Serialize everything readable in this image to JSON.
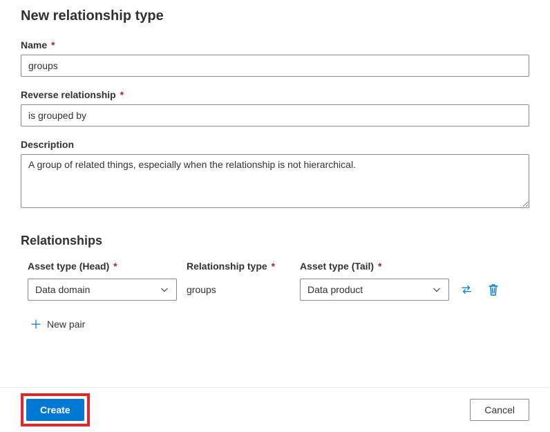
{
  "title": "New relationship type",
  "fields": {
    "name": {
      "label": "Name",
      "value": "groups"
    },
    "reverse": {
      "label": "Reverse relationship",
      "value": "is grouped by"
    },
    "description": {
      "label": "Description",
      "value": "A group of related things, especially when the relationship is not hierarchical."
    }
  },
  "relationships": {
    "heading": "Relationships",
    "columns": {
      "head": "Asset type (Head)",
      "relType": "Relationship type",
      "tail": "Asset type (Tail)"
    },
    "rows": [
      {
        "head": "Data domain",
        "relType": "groups",
        "tail": "Data product"
      }
    ],
    "newPairLabel": "New pair"
  },
  "footer": {
    "create": "Create",
    "cancel": "Cancel"
  },
  "required_marker": "*"
}
